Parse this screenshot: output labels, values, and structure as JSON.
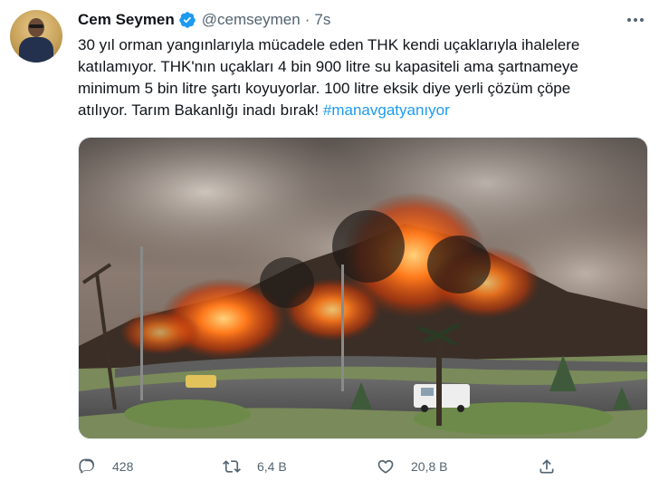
{
  "tweet": {
    "author_name": "Cem Seymen",
    "handle": "@cemseymen",
    "separator": "·",
    "time": "7s",
    "text_lines": [
      "30 yıl orman yangınlarıyla mücadele eden THK kendi uçaklarıyla ihalelere",
      "katılamıyor. THK'nın uçakları 4 bin 900 litre su kapasiteli ama şartnameye",
      "minimum 5 bin litre şartı koyuyorlar. 100 litre eksik diye yerli çözüm çöpe",
      "atılıyor. Tarım Bakanlığı inadı bırak!"
    ],
    "hashtag": "#manavgatyanıyor",
    "verified": true
  },
  "actions": {
    "replies": "428",
    "retweets": "6,4 B",
    "likes": "20,8 B"
  },
  "icons": [
    "verified-badge-icon",
    "more-icon",
    "reply-icon",
    "retweet-icon",
    "like-icon",
    "share-icon"
  ],
  "colors": {
    "accent": "#1d9bf0",
    "text": "#0f1419",
    "secondary": "#536471"
  }
}
